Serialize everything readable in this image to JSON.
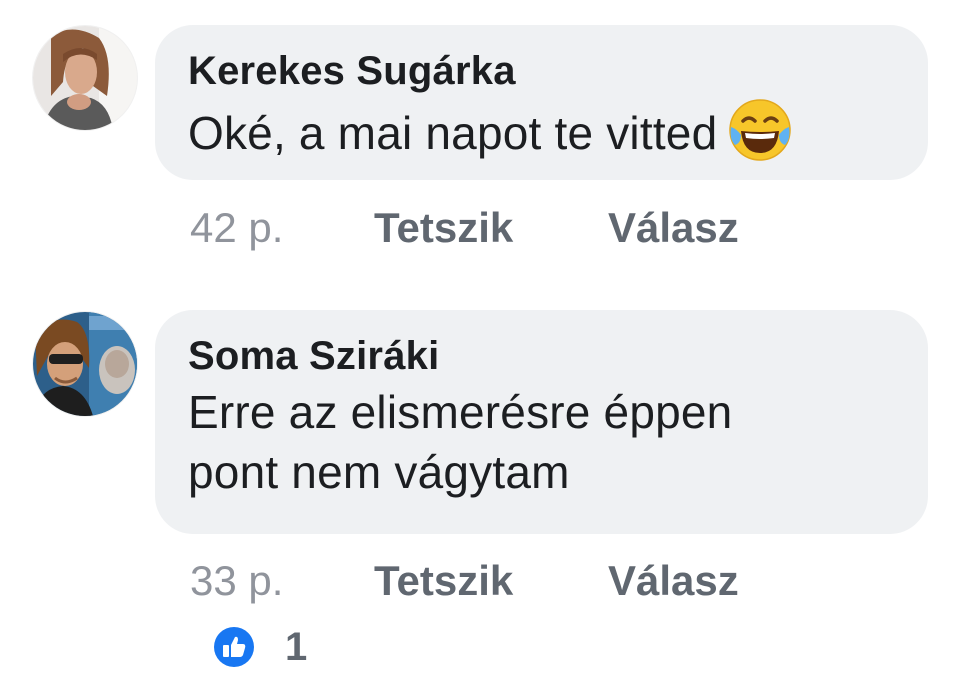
{
  "comments": [
    {
      "author": "Kerekes Sugárka",
      "text": "Oké, a mai napot te vitted",
      "emoji_icon": "face-with-tears-of-joy-icon",
      "time": "42 p.",
      "like_label": "Tetszik",
      "reply_label": "Válasz"
    },
    {
      "author": "Soma Sziráki",
      "text_line1": "Erre az elismerésre éppen",
      "text_line2": "pont nem vágytam",
      "time": "33 p.",
      "like_label": "Tetszik",
      "reply_label": "Válasz",
      "reaction_icon": "thumbs-up-icon",
      "reaction_count": "1"
    }
  ],
  "colors": {
    "bubble_background": "#eff1f3",
    "author_text": "#1c1e21",
    "meta_text": "#90949c",
    "action_text": "#606770",
    "like_badge": "#1877f2"
  }
}
